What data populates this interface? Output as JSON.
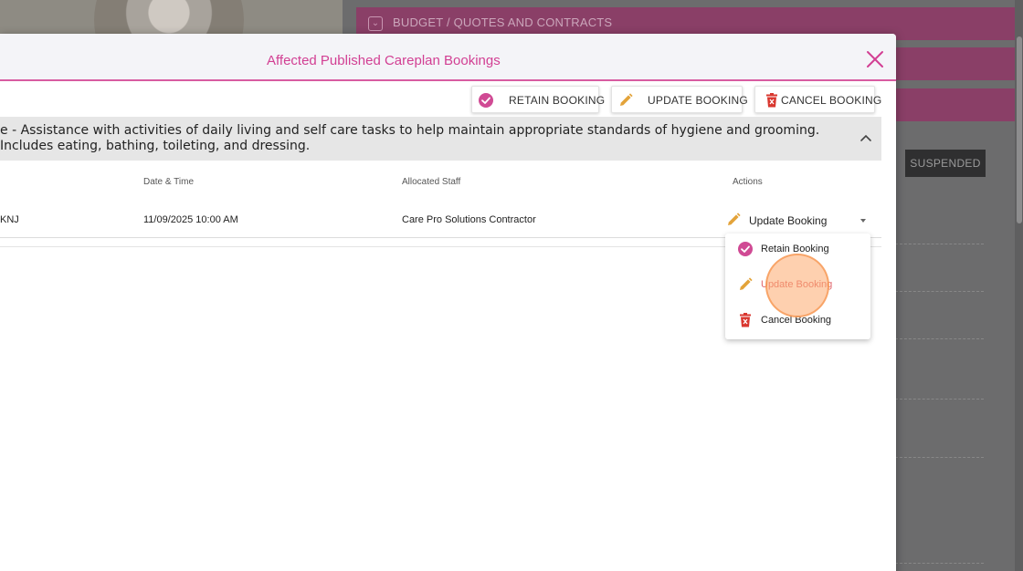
{
  "background": {
    "sections": [
      {
        "label": "BUDGET / QUOTES AND CONTRACTS"
      },
      {
        "label": ""
      },
      {
        "label": ""
      }
    ],
    "status_badge": "SUSPENDED"
  },
  "modal": {
    "title": "Affected Published Careplan Bookings",
    "actions": {
      "retain_label": "RETAIN BOOKING",
      "update_label": "UPDATE BOOKING",
      "cancel_label": "CANCEL BOOKING"
    },
    "service_description": "e - Assistance with activities of daily living and self care tasks to help maintain appropriate standards of hygiene and grooming. Includes eating, bathing, toileting, and dressing.",
    "table": {
      "headers": {
        "date_time": "Date & Time",
        "allocated_staff": "Allocated Staff",
        "actions": "Actions"
      },
      "rows": [
        {
          "client_fragment": "KNJ",
          "date_time": "11/09/2025 10:00 AM",
          "allocated_staff": "Care Pro Solutions Contractor",
          "action_selected": "Update Booking"
        }
      ]
    },
    "action_menu": {
      "items": [
        {
          "label": "Retain Booking",
          "icon": "check-circle-icon"
        },
        {
          "label": "Update Booking",
          "icon": "pencil-icon"
        },
        {
          "label": "Cancel Booking",
          "icon": "trash-icon"
        }
      ]
    }
  },
  "colors": {
    "accent": "#d23f93",
    "retain": "#d04a94",
    "update": "#e3a33a",
    "cancel": "#d9372f"
  }
}
